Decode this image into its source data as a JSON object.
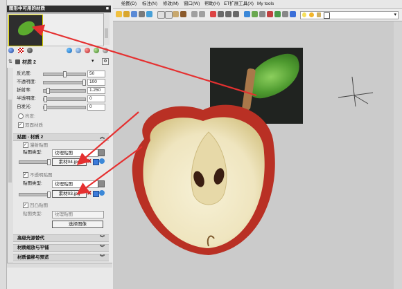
{
  "panel": {
    "title": "图形中可用的材质",
    "material_name": "材质 2",
    "params": [
      {
        "label": "反光度:",
        "value": "50",
        "pos": 0.5
      },
      {
        "label": "不透明度:",
        "value": "100",
        "pos": 0.98
      },
      {
        "label": "折射率:",
        "value": "1.250",
        "pos": 0.08
      },
      {
        "label": "半透明度:",
        "value": "0",
        "pos": 0.0
      },
      {
        "label": "自发光:",
        "value": "0",
        "pos": 0.0
      }
    ],
    "luminance_label": "亮度:",
    "two_sided_label": "双面材质",
    "map_section_title": "贴图 - 材质 2",
    "diffuse": {
      "check_label": "漫射贴图",
      "type_label": "贴图类型:",
      "type_value": "纹理贴图",
      "file_button": "素材04.jpg"
    },
    "opacity": {
      "check_label": "不透明贴图",
      "type_label": "贴图类型:",
      "type_value": "纹理贴图",
      "file_button": "素材03.jpg"
    },
    "bump": {
      "check_label": "凹凸贴图",
      "type_label": "贴图类型:",
      "type_value": "纹理贴图",
      "select_button": "选择图像"
    },
    "collapsed_sections": [
      "高级光源替代",
      "材质缩放与平铺",
      "材质偏移与预览"
    ]
  },
  "menubar": {
    "items": [
      "绘图(D)",
      "标注(N)",
      "修改(M)",
      "窗口(W)",
      "帮助(H)",
      "ET扩展工具(X)",
      "My tools"
    ]
  },
  "colors": {
    "arrow": "#e53030",
    "panel_bg": "#e9e9e9",
    "viewport_bg": "#cbcbcb",
    "header_bg": "#2f2f2f"
  }
}
